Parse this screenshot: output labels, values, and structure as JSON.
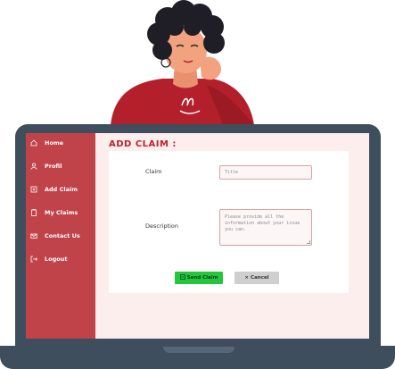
{
  "sidebar": {
    "items": [
      {
        "label": "Home",
        "icon": "home-icon"
      },
      {
        "label": "Profil",
        "icon": "user-icon"
      },
      {
        "label": "Add Claim",
        "icon": "add-document-icon"
      },
      {
        "label": "My Claims",
        "icon": "clipboard-icon"
      },
      {
        "label": "Contact Us",
        "icon": "mail-icon"
      },
      {
        "label": "Logout",
        "icon": "logout-icon"
      }
    ]
  },
  "main": {
    "title": "ADD CLAIM :",
    "form": {
      "claim_label": "Claim",
      "claim_placeholder": "Title",
      "description_label": "Description",
      "description_placeholder": "Please provide all the information about your issue you can."
    },
    "buttons": {
      "send_label": "Send Claim",
      "cancel_label": "Cancel"
    }
  },
  "colors": {
    "sidebar": "#c1434a",
    "accent": "#b8242c",
    "send": "#23c63d",
    "screen_bg": "#fdeeee",
    "laptop": "#3e4e5c"
  }
}
